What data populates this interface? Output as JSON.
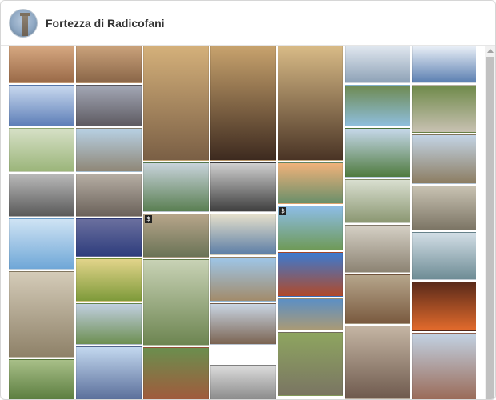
{
  "header": {
    "title": "Fortezza di Radicofani",
    "avatar_label": "page avatar"
  },
  "photo_badge_label": "$",
  "tiles": [
    {
      "name": "photo-stone-wall-1",
      "bg": "#9a6a48",
      "bg2": "#d5a780"
    },
    {
      "name": "photo-stone-wall-2",
      "bg": "#8a6648",
      "bg2": "#c9a17a"
    },
    {
      "name": "photo-arch-passage",
      "bg": "#7a5f45",
      "bg2": "#d4b07a"
    },
    {
      "name": "photo-bright-doorway",
      "bg": "#3d2a1f",
      "bg2": "#c7a26d"
    },
    {
      "name": "photo-bright-doorway-2",
      "bg": "#4a3425",
      "bg2": "#d8ba86"
    },
    {
      "name": "photo-snow-ruin",
      "bg": "#8ea2b7",
      "bg2": "#dfe6ee"
    },
    {
      "name": "photo-snow-village",
      "bg": "#5b7fb1",
      "bg2": "#e8eef6"
    },
    {
      "name": "photo-blue-tower",
      "bg": "#5e7fb8",
      "bg2": "#c9d9ef"
    },
    {
      "name": "photo-dark-landscape",
      "bg": "#5e5b62",
      "bg2": "#a3a7b5"
    },
    {
      "name": "photo-tower-skyline",
      "bg": "#8ebedc",
      "bg2": "#6e8a52"
    },
    {
      "name": "photo-courtyard",
      "bg": "#c8c1b2",
      "bg2": "#6f8a4a"
    },
    {
      "name": "photo-hill-green",
      "bg": "#9bb57a",
      "bg2": "#d6e0c6"
    },
    {
      "name": "photo-castle-ruin",
      "bg": "#8f8777",
      "bg2": "#b7d0e3"
    },
    {
      "name": "photo-rolling-hills",
      "bg": "#5a7f52",
      "bg2": "#c8d3db"
    },
    {
      "name": "photo-bw-tree",
      "bg": "#3f3f3f",
      "bg2": "#cfcfcf"
    },
    {
      "name": "photo-sunset-hills",
      "bg": "#6a8f6a",
      "bg2": "#f0b27a"
    },
    {
      "name": "photo-hiker",
      "bg": "#4f7b3f",
      "bg2": "#c6d8ea"
    },
    {
      "name": "photo-fortress-green",
      "bg": "#8c7d62",
      "bg2": "#c3d4e5"
    },
    {
      "name": "photo-bw-valley",
      "bg": "#5a5a5a",
      "bg2": "#b8b8b8"
    },
    {
      "name": "photo-sepia-hills",
      "bg": "#6b625a",
      "bg2": "#b5ada3"
    },
    {
      "name": "photo-blue-sky-fields",
      "bg": "#6f9a58",
      "bg2": "#8dbde6"
    },
    {
      "name": "photo-foggy-hills",
      "bg": "#8b9772",
      "bg2": "#d9dfd0"
    },
    {
      "name": "photo-stone-gate",
      "bg": "#7c7565",
      "bg2": "#c8c2b2"
    },
    {
      "name": "photo-sky-blue",
      "bg": "#6fa7d7",
      "bg2": "#cfe3f4"
    },
    {
      "name": "photo-night-fortress",
      "bg": "#2e3d7d",
      "bg2": "#6a6f9e"
    },
    {
      "name": "photo-collage-1",
      "bg": "#6a7356",
      "bg2": "#b7a58a"
    },
    {
      "name": "photo-landscape-blue",
      "bg": "#5c7ea6",
      "bg2": "#e4dfcb"
    },
    {
      "name": "photo-red-tower",
      "bg": "#b04a2a",
      "bg2": "#3c7ad0"
    },
    {
      "name": "photo-stone-arch",
      "bg": "#8c8373",
      "bg2": "#d5d0c5"
    },
    {
      "name": "photo-misty-mountain",
      "bg": "#6e8c95",
      "bg2": "#d2dee6"
    },
    {
      "name": "photo-arcade",
      "bg": "#8e8168",
      "bg2": "#d4cbb8"
    },
    {
      "name": "photo-tuscan-fields",
      "bg": "#7e9a3a",
      "bg2": "#e2d48a"
    },
    {
      "name": "photo-aerial-fortress",
      "bg": "#6d8551",
      "bg2": "#c8d2b5"
    },
    {
      "name": "photo-tall-tower",
      "bg": "#a28b6a",
      "bg2": "#9ec6e8"
    },
    {
      "name": "photo-fortress-flowers",
      "bg": "#a99a76",
      "bg2": "#5c8fc4"
    },
    {
      "name": "photo-collage-2",
      "bg": "#7a5a3f",
      "bg2": "#b5a58b"
    },
    {
      "name": "photo-orange-sunset",
      "bg": "#e36b2c",
      "bg2": "#5a2a1a"
    },
    {
      "name": "photo-green-valley",
      "bg": "#6d8f52",
      "bg2": "#c1cfe0"
    },
    {
      "name": "photo-twin-towers",
      "bg": "#7b6452",
      "bg2": "#c9d5e3"
    },
    {
      "name": "photo-stone-ruin-green",
      "bg": "#7a7562",
      "bg2": "#8ea560"
    },
    {
      "name": "photo-fortress-dusk",
      "bg": "#6f5a4e",
      "bg2": "#c4b5a3"
    },
    {
      "name": "photo-red-fortress",
      "bg": "#9a6a57",
      "bg2": "#c2d2e3"
    },
    {
      "name": "photo-aerial-green",
      "bg": "#5b7d3f",
      "bg2": "#a8bf88"
    },
    {
      "name": "photo-castle-tower-sky",
      "bg": "#5a6e9a",
      "bg2": "#c3d8ef"
    },
    {
      "name": "photo-ornate-gate",
      "bg": "#a15a3c",
      "bg2": "#6b8e4e"
    },
    {
      "name": "photo-bw-tower-print",
      "bg": "#8a8a8a",
      "bg2": "#dcdcdc"
    }
  ]
}
